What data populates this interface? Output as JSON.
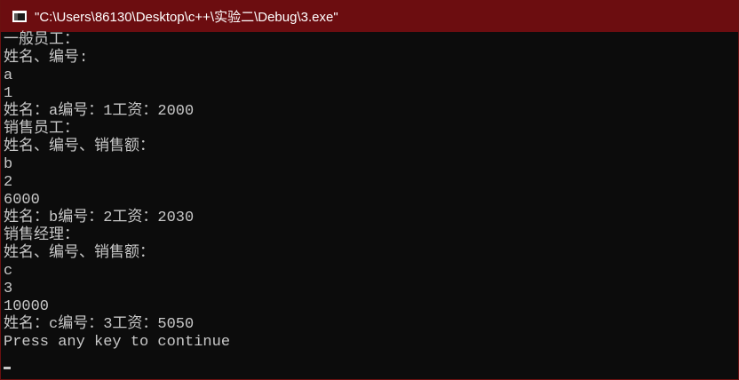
{
  "window": {
    "title": "\"C:\\Users\\86130\\Desktop\\c++\\实验二\\Debug\\3.exe\"",
    "icon": "console-window-icon",
    "titlebar_color": "#6c0d10"
  },
  "console": {
    "text_color": "#c8c8c8",
    "background": "#0c0c0c",
    "lines": [
      "一般员工：",
      "姓名、编号:",
      "a",
      "1",
      "姓名：a编号：1工资：2000",
      "销售员工：",
      "姓名、编号、销售额：",
      "b",
      "2",
      "6000",
      "姓名：b编号：2工资：2030",
      "销售经理：",
      "姓名、编号、销售额：",
      "c",
      "3",
      "10000",
      "姓名：c编号：3工资：5050",
      "Press any key to continue"
    ]
  }
}
